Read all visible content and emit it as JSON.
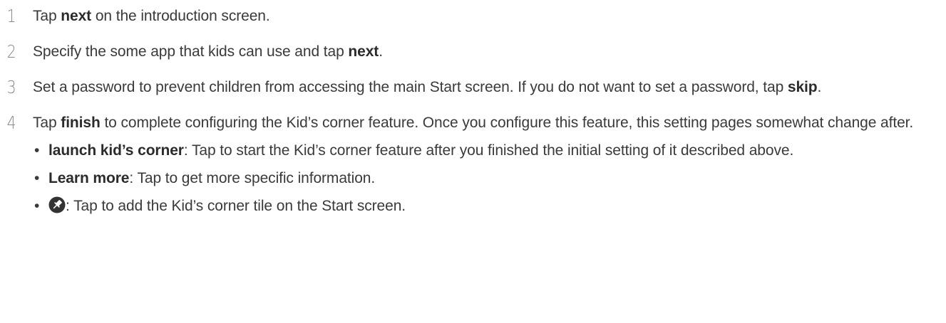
{
  "steps": [
    {
      "number": "1",
      "before": "Tap ",
      "keyword": "next",
      "after": " on the introduction screen."
    },
    {
      "number": "2",
      "before": "Specify the some app that kids can use and tap ",
      "keyword": "next",
      "after": "."
    },
    {
      "number": "3",
      "before": "Set a password to prevent children from accessing the main Start screen. If you do not want to set a password, tap ",
      "keyword": "skip",
      "after": "."
    },
    {
      "number": "4",
      "before": "Tap ",
      "keyword": "finish",
      "after": " to complete configuring the Kid’s corner feature. Once you configure this feature, this setting pages somewhat change after."
    }
  ],
  "bullets": [
    {
      "term": "launch kid’s corner",
      "text": ": Tap to start the Kid’s corner feature after you finished the initial setting of it described above."
    },
    {
      "term": "Learn more",
      "text": ": Tap to get more specific information."
    },
    {
      "icon": "pin-icon",
      "text": ": Tap to add the Kid’s corner tile on the Start screen."
    }
  ],
  "bullet_symbol": "•",
  "colors": {
    "text": "#3a3a3a",
    "number": "#8a8a8a",
    "keyword": "#2b2b2b",
    "icon_bg": "#333333"
  }
}
